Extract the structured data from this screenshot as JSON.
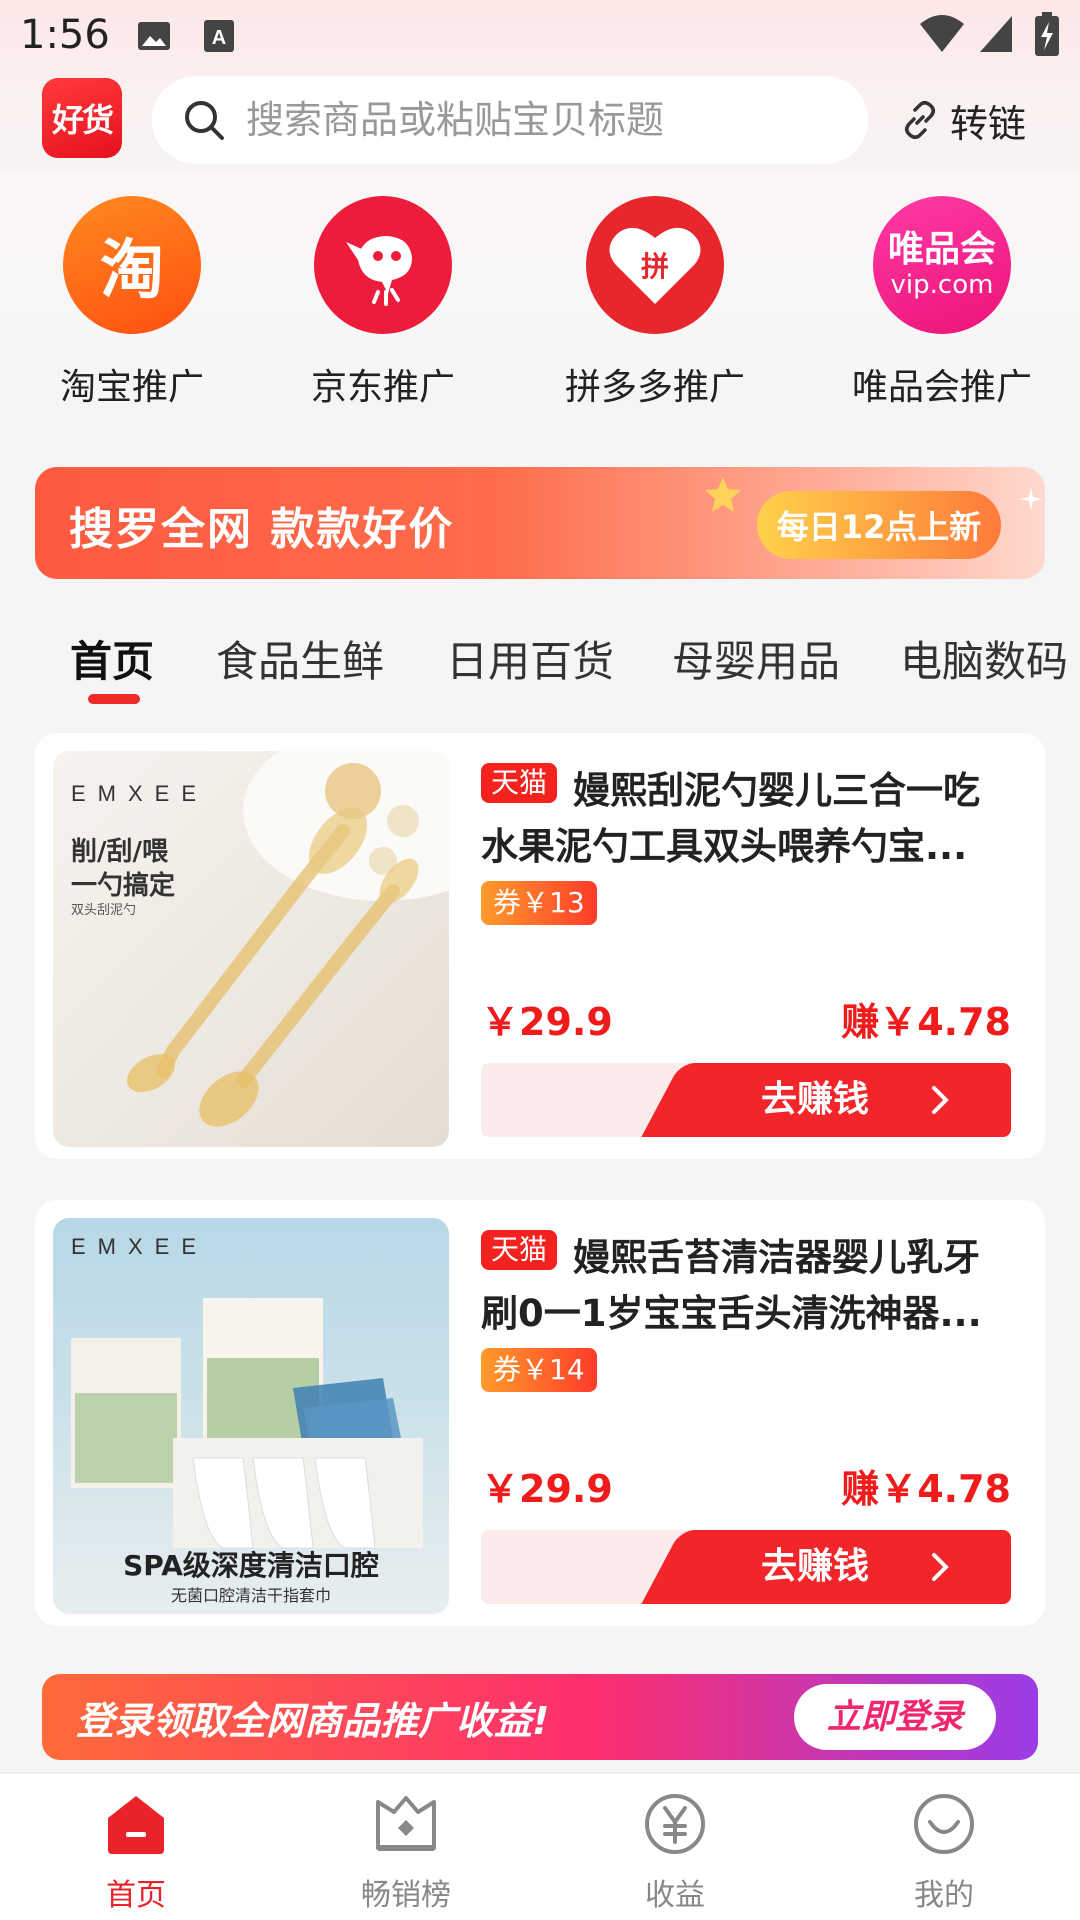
{
  "status_bar": {
    "time": "1:56"
  },
  "header": {
    "logo_text": "好货",
    "search_placeholder": "搜索商品或粘贴宝贝标题",
    "link_label": "转链"
  },
  "platforms": [
    {
      "label": "淘宝推广",
      "icon_text": "淘",
      "color": "#ff6a1a"
    },
    {
      "label": "京东推广",
      "icon_text": "",
      "color": "#ee1c3c"
    },
    {
      "label": "拼多多推广",
      "icon_text": "拼",
      "color": "#e8262d"
    },
    {
      "label": "唯品会推广",
      "icon_text": "唯品会",
      "icon_sub": "vip.com",
      "color": "#f01f8d"
    }
  ],
  "banner": {
    "title": "搜罗全网 款款好价",
    "tag": "每日12点上新"
  },
  "tabs": [
    {
      "label": "首页",
      "active": true
    },
    {
      "label": "食品生鲜"
    },
    {
      "label": "日用百货"
    },
    {
      "label": "母婴用品"
    },
    {
      "label": "电脑数码"
    }
  ],
  "products": [
    {
      "shop_tag": "天猫",
      "title": "嫚熙刮泥勺婴儿三合一吃水果泥勺工具双头喂养勺宝...",
      "coupon": "券￥13",
      "price": "￥29.9",
      "earn": "赚￥4.78",
      "action": "去赚钱",
      "img_brand": "EMXEE",
      "img_line1": "削/刮/喂",
      "img_line2": "一勺搞定",
      "img_line3": "双头刮泥勺"
    },
    {
      "shop_tag": "天猫",
      "title": "嫚熙舌苔清洁器婴儿乳牙刷0一1岁宝宝舌头清洗神器...",
      "coupon": "券￥14",
      "price": "￥29.9",
      "earn": "赚￥4.78",
      "action": "去赚钱",
      "img_brand": "EMXEE",
      "img_line1": "SPA级深度清洁口腔",
      "img_line2": "无菌口腔清洁干指套巾"
    }
  ],
  "login_banner": {
    "text": "登录领取全网商品推广收益!",
    "button": "立即登录"
  },
  "bottom_nav": [
    {
      "label": "首页",
      "icon": "home-icon",
      "active": true
    },
    {
      "label": "畅销榜",
      "icon": "ranking-icon"
    },
    {
      "label": "收益",
      "icon": "yen-icon"
    },
    {
      "label": "我的",
      "icon": "smile-icon"
    }
  ],
  "colors": {
    "accent": "#e8232a",
    "price": "#f01b1b",
    "tab_underline": "#ee2a2a"
  }
}
